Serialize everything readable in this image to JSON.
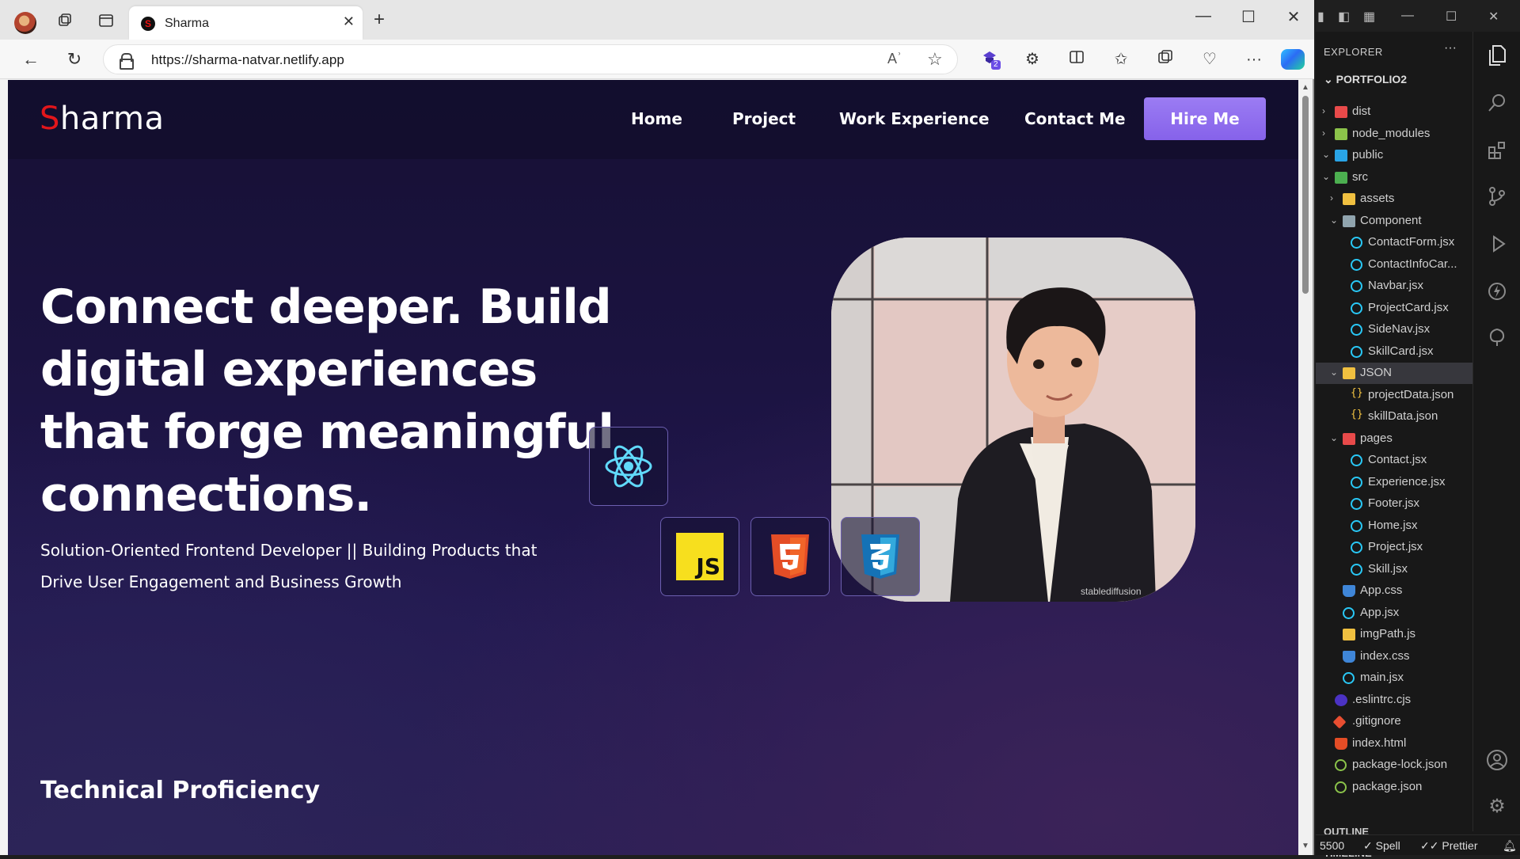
{
  "browser": {
    "tab_title": "Sharma",
    "tab_favicon_letter": "S",
    "url": "https://sharma-natvar.netlify.app",
    "read_aloud_label": "Aʾ",
    "extension_badge": "2"
  },
  "site": {
    "logo_first": "S",
    "logo_rest": "harma",
    "nav": {
      "home": "Home",
      "project": "Project",
      "work": "Work Experience",
      "contact": "Contact Me",
      "hire": "Hire Me"
    },
    "hero_title": "Connect deeper. Build digital experiences that forge meaningful connections.",
    "hero_subtitle": "Solution-Oriented Frontend Developer || Building Products that Drive User Engagement and Business Growth",
    "portrait_watermark": "stablediffusion",
    "js_label": "JS",
    "tech_heading": "Technical Proficiency"
  },
  "vscode": {
    "explorer_title": "EXPLORER",
    "more": "···",
    "project": "PORTFOLIO2",
    "tree": [
      {
        "label": "dist",
        "depth": 0,
        "chev": ">",
        "icon": "folder-red"
      },
      {
        "label": "node_modules",
        "depth": 0,
        "chev": ">",
        "icon": "folder-green"
      },
      {
        "label": "public",
        "depth": 0,
        "chev": "v",
        "icon": "folder-blue"
      },
      {
        "label": "src",
        "depth": 0,
        "chev": "v",
        "icon": "folder-teal"
      },
      {
        "label": "assets",
        "depth": 1,
        "chev": ">",
        "icon": "folder-yellow"
      },
      {
        "label": "Component",
        "depth": 1,
        "chev": "v",
        "icon": "folder-gray"
      },
      {
        "label": "ContactForm.jsx",
        "depth": 2,
        "chev": "",
        "icon": "react"
      },
      {
        "label": "ContactInfoCar...",
        "depth": 2,
        "chev": "",
        "icon": "react"
      },
      {
        "label": "Navbar.jsx",
        "depth": 2,
        "chev": "",
        "icon": "react"
      },
      {
        "label": "ProjectCard.jsx",
        "depth": 2,
        "chev": "",
        "icon": "react"
      },
      {
        "label": "SideNav.jsx",
        "depth": 2,
        "chev": "",
        "icon": "react"
      },
      {
        "label": "SkillCard.jsx",
        "depth": 2,
        "chev": "",
        "icon": "react"
      },
      {
        "label": "JSON",
        "depth": 1,
        "chev": "v",
        "icon": "folder-yellow",
        "selected": true
      },
      {
        "label": "projectData.json",
        "depth": 2,
        "chev": "",
        "icon": "json"
      },
      {
        "label": "skillData.json",
        "depth": 2,
        "chev": "",
        "icon": "json"
      },
      {
        "label": "pages",
        "depth": 1,
        "chev": "v",
        "icon": "folder-red"
      },
      {
        "label": "Contact.jsx",
        "depth": 2,
        "chev": "",
        "icon": "react"
      },
      {
        "label": "Experience.jsx",
        "depth": 2,
        "chev": "",
        "icon": "react"
      },
      {
        "label": "Footer.jsx",
        "depth": 2,
        "chev": "",
        "icon": "react"
      },
      {
        "label": "Home.jsx",
        "depth": 2,
        "chev": "",
        "icon": "react"
      },
      {
        "label": "Project.jsx",
        "depth": 2,
        "chev": "",
        "icon": "react"
      },
      {
        "label": "Skill.jsx",
        "depth": 2,
        "chev": "",
        "icon": "react"
      },
      {
        "label": "App.css",
        "depth": 1,
        "chev": "",
        "icon": "css"
      },
      {
        "label": "App.jsx",
        "depth": 1,
        "chev": "",
        "icon": "react"
      },
      {
        "label": "imgPath.js",
        "depth": 1,
        "chev": "",
        "icon": "js"
      },
      {
        "label": "index.css",
        "depth": 1,
        "chev": "",
        "icon": "css"
      },
      {
        "label": "main.jsx",
        "depth": 1,
        "chev": "",
        "icon": "react"
      },
      {
        "label": ".eslintrc.cjs",
        "depth": 0,
        "chev": "",
        "icon": "eslint"
      },
      {
        "label": ".gitignore",
        "depth": 0,
        "chev": "",
        "icon": "git"
      },
      {
        "label": "index.html",
        "depth": 0,
        "chev": "",
        "icon": "html"
      },
      {
        "label": "package-lock.json",
        "depth": 0,
        "chev": "",
        "icon": "npm"
      },
      {
        "label": "package.json",
        "depth": 0,
        "chev": "",
        "icon": "npm"
      }
    ],
    "outline": "OUTLINE",
    "timeline": "TIMELINE",
    "status": {
      "port": "5500",
      "spell": "✓ Spell",
      "prettier": "✓✓ Prettier"
    }
  },
  "colors": {
    "logo_accent": "#e3161b",
    "hire_button": "#8662ea",
    "page_bg": "#1b1340",
    "skill_border": "#6c5fb0"
  }
}
